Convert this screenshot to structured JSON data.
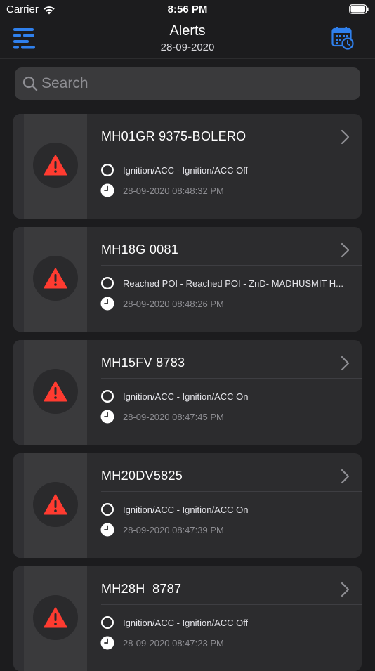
{
  "status_bar": {
    "carrier": "Carrier",
    "time": "8:56 PM"
  },
  "header": {
    "title": "Alerts",
    "date": "28-09-2020"
  },
  "search": {
    "placeholder": "Search",
    "value": ""
  },
  "colors": {
    "accent": "#2f80ed",
    "warning": "#ff3b30",
    "background": "#1c1c1e",
    "card": "#2c2c2e"
  },
  "icons": {
    "menu": "menu-lines-icon",
    "calendar": "calendar-clock-icon",
    "alert": "warning-triangle-icon",
    "status": "circle-outline-icon",
    "time": "clock-icon",
    "chevron": "chevron-right-icon"
  },
  "alerts": [
    {
      "vehicle": "MH01GR 9375-BOLERO",
      "message": "Ignition/ACC - Ignition/ACC Off",
      "timestamp": "28-09-2020 08:48:32 PM"
    },
    {
      "vehicle": "MH18G 0081",
      "message": "Reached POI - Reached POI - ZnD- MADHUSMIT H...",
      "timestamp": "28-09-2020 08:48:26 PM"
    },
    {
      "vehicle": "MH15FV 8783",
      "message": "Ignition/ACC - Ignition/ACC On",
      "timestamp": "28-09-2020 08:47:45 PM"
    },
    {
      "vehicle": "MH20DV5825",
      "message": "Ignition/ACC - Ignition/ACC On",
      "timestamp": "28-09-2020 08:47:39 PM"
    },
    {
      "vehicle": "MH28H  8787",
      "message": "Ignition/ACC - Ignition/ACC Off",
      "timestamp": "28-09-2020 08:47:23 PM"
    }
  ]
}
